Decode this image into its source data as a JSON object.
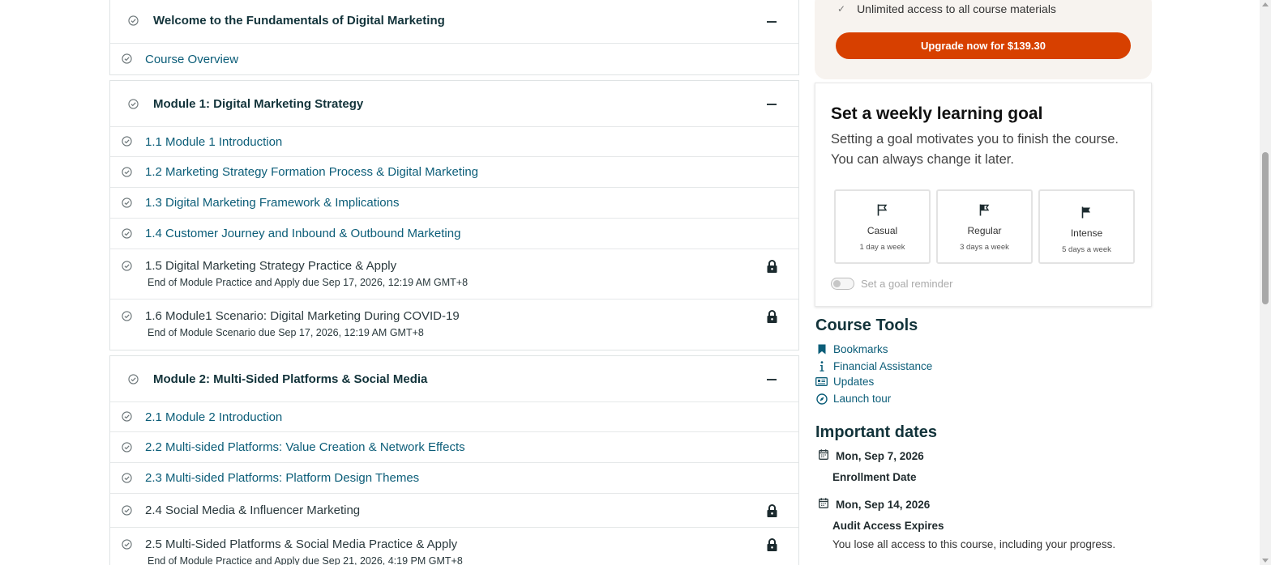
{
  "outline": {
    "sections": [
      {
        "title": "Welcome to the Fundamentals of Digital Marketing",
        "items": [
          {
            "title": "Course Overview",
            "type": "link"
          }
        ]
      },
      {
        "title": "Module 1: Digital Marketing Strategy",
        "items": [
          {
            "title": "1.1 Module 1 Introduction",
            "type": "link"
          },
          {
            "title": "1.2 Marketing Strategy Formation Process & Digital Marketing",
            "type": "link"
          },
          {
            "title": "1.3 Digital Marketing Framework & Implications",
            "type": "link"
          },
          {
            "title": "1.4 Customer Journey and Inbound & Outbound Marketing",
            "type": "link"
          },
          {
            "title": "1.5 Digital Marketing Strategy Practice & Apply",
            "type": "locked",
            "due": "End of Module Practice and Apply due Sep 17, 2026, 12:19 AM GMT+8"
          },
          {
            "title": "1.6 Module1 Scenario: Digital Marketing During COVID-19",
            "type": "locked",
            "due": "End of Module Scenario due Sep 17, 2026, 12:19 AM GMT+8"
          }
        ]
      },
      {
        "title": "Module 2: Multi-Sided Platforms & Social Media",
        "items": [
          {
            "title": "2.1 Module 2 Introduction",
            "type": "link"
          },
          {
            "title": "2.2 Multi-sided Platforms: Value Creation & Network Effects",
            "type": "link"
          },
          {
            "title": "2.3 Multi-sided Platforms: Platform Design Themes",
            "type": "link"
          },
          {
            "title": "2.4 Social Media & Influencer Marketing",
            "type": "locked"
          },
          {
            "title": "2.5 Multi-Sided Platforms & Social Media Practice & Apply",
            "type": "locked",
            "due": "End of Module Practice and Apply due Sep 21, 2026, 4:19 PM GMT+8"
          }
        ]
      }
    ]
  },
  "upgrade": {
    "access_text": "Unlimited access to all course materials",
    "button_label": "Upgrade now for $139.30"
  },
  "goal": {
    "title": "Set a weekly learning goal",
    "description": "Setting a goal motivates you to finish the course. You can always change it later.",
    "options": [
      {
        "name": "Casual",
        "freq": "1 day a week",
        "icon": "flag-outline-icon"
      },
      {
        "name": "Regular",
        "freq": "3 days a week",
        "icon": "flag-half-icon"
      },
      {
        "name": "Intense",
        "freq": "5 days a week",
        "icon": "flag-filled-icon"
      }
    ],
    "reminder_label": "Set a goal reminder"
  },
  "tools": {
    "title": "Course Tools",
    "items": [
      {
        "label": "Bookmarks",
        "icon": "bookmark-icon"
      },
      {
        "label": "Financial Assistance",
        "icon": "info-icon"
      },
      {
        "label": "Updates",
        "icon": "newspaper-icon"
      },
      {
        "label": "Launch tour",
        "icon": "compass-icon"
      }
    ]
  },
  "dates": {
    "title": "Important dates",
    "items": [
      {
        "date": "Mon, Sep 7, 2026",
        "label": "Enrollment Date"
      },
      {
        "date": "Mon, Sep 14, 2026",
        "label": "Audit Access Expires",
        "desc": "You lose all access to this course, including your progress."
      }
    ]
  },
  "colors": {
    "link": "#0b5d78",
    "brand_orange": "#d74000",
    "heading": "#12333a"
  }
}
